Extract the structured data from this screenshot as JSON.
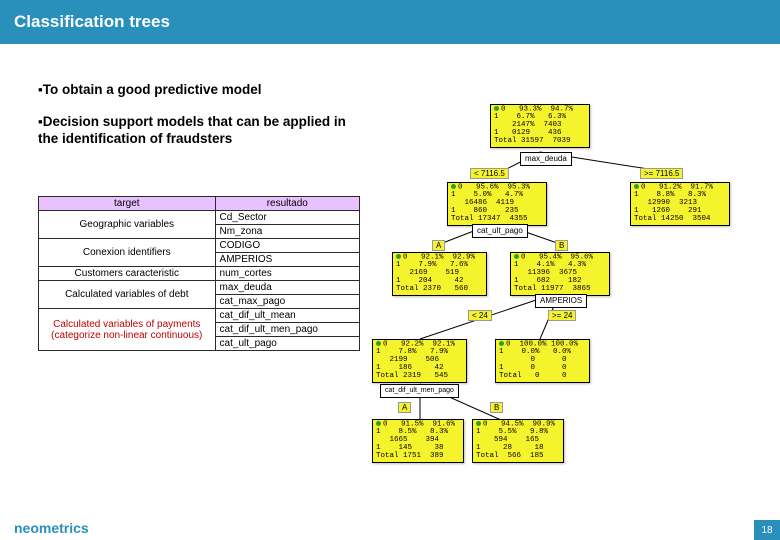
{
  "title": "Classification trees",
  "bullets": {
    "b1": "▪To obtain a good predictive model",
    "b2": "▪Decision support models that can be applied in the identification of fraudsters"
  },
  "var_table": {
    "header": [
      "target",
      "resultado"
    ],
    "rows": [
      {
        "group": "Geographic variables",
        "vars": [
          "Cd_Sector",
          "Nm_zona"
        ]
      },
      {
        "group": "Conexion identifiers",
        "vars": [
          "CODIGO",
          "AMPERIOS"
        ]
      },
      {
        "group": "Customers caracteristic",
        "vars": [
          "num_cortes"
        ]
      },
      {
        "group": "Calculated variables of debt",
        "vars": [
          "max_deuda",
          "cat_max_pago"
        ]
      },
      {
        "group": "Calculated variables of payments (categorize non-linear continuous)",
        "red": true,
        "vars": [
          "cat_dif_ult_mean",
          "cat_dif_ult_men_pago",
          "cat_ult_pago"
        ]
      }
    ]
  },
  "tree": {
    "root": {
      "rows": [
        "0   93.3%  94.7%",
        "1    6.7%   6.3%",
        "    2147%  7403",
        "1   0129    436",
        "Total 31597  7039"
      ],
      "split": "max_deuda",
      "branches": [
        "< 7116.5",
        ">= 7116.5"
      ]
    },
    "l1_left": {
      "rows": [
        "0   95.6%  95.3%",
        "1    5.0%   4.7%",
        "   16486  4119",
        "1    860    235",
        "Total 17347  4355"
      ],
      "split": "cat_ult_pago",
      "branches": [
        "A",
        "B"
      ]
    },
    "l1_right": {
      "rows": [
        "0   91.2%  91.7%",
        "1    8.8%   8.3%",
        "   12990  3213",
        "1   1260    291",
        "Total 14250  3504"
      ]
    },
    "l2_a": {
      "rows": [
        "0   92.1%  92.9%",
        "1    7.9%   7.6%",
        "   2169    519",
        "1    204     42",
        "Total 2370   560"
      ]
    },
    "l2_b": {
      "rows": [
        "0   95.4%  95.6%",
        "1    4.1%   4.3%",
        "   11396  3675",
        "1    682    182",
        "Total 11977  3865"
      ],
      "split": "AMPERIOS",
      "branches": [
        "< 24",
        ">= 24"
      ]
    },
    "l3_a": {
      "rows": [
        "0   92.2%  92.1%",
        "1    7.8%   7.9%",
        "   2199    506",
        "1    186     42",
        "Total 2319   545"
      ],
      "split": "cat_dif_ult_men_pago",
      "branches": [
        "A",
        "B"
      ]
    },
    "l3_b": {
      "rows": [
        "0  100.0% 100.0%",
        "1    0.0%   0.0%",
        "       0      0",
        "1      0      0",
        "Total   0     0"
      ]
    },
    "l4_a": {
      "rows": [
        "0   91.5%  91.6%",
        "1    8.5%   8.3%",
        "   1665    394",
        "1    145     38",
        "Total 1751  389"
      ]
    },
    "l4_b": {
      "rows": [
        "0   94.5%  90.9%",
        "1    5.5%   9.8%",
        "    594    165",
        "1     28     18",
        "Total  566  185"
      ]
    }
  },
  "footer": {
    "brand": "neometrics",
    "page": "18"
  }
}
